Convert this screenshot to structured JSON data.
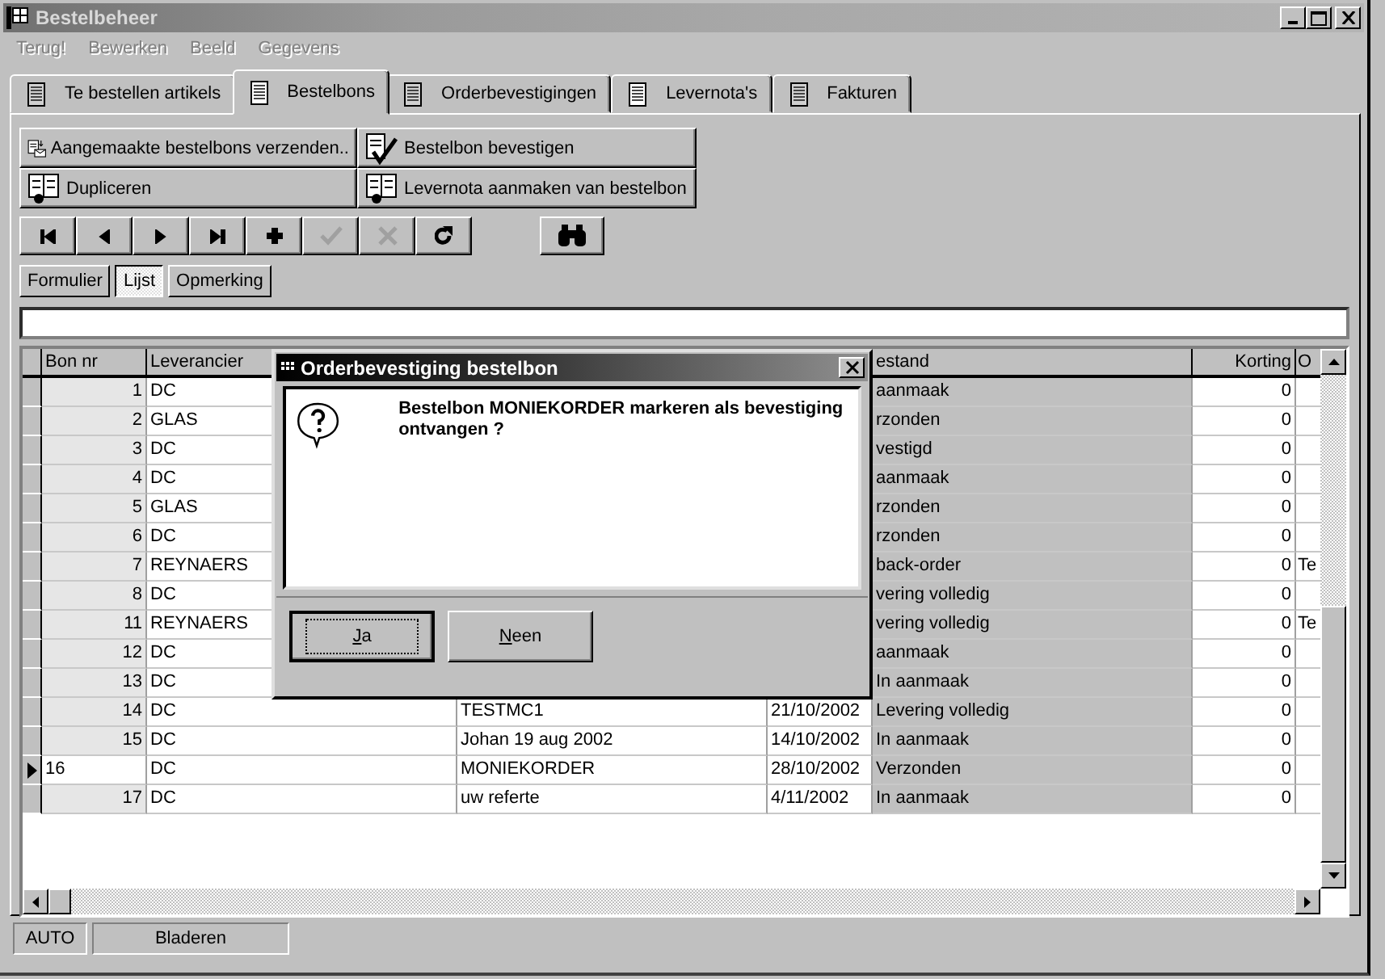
{
  "window": {
    "title": "Bestelbeheer"
  },
  "menu": [
    {
      "label": "Terug!",
      "disabled": true
    },
    {
      "label": "Bewerken",
      "disabled": true
    },
    {
      "label": "Beeld",
      "disabled": true
    },
    {
      "label": "Gegevens",
      "disabled": true
    }
  ],
  "tabs": [
    {
      "label": "Te bestellen artikels",
      "selected": false
    },
    {
      "label": "Bestelbons",
      "selected": true
    },
    {
      "label": "Orderbevestigingen",
      "selected": false
    },
    {
      "label": "Levernota's",
      "selected": false
    },
    {
      "label": "Fakturen",
      "selected": false
    }
  ],
  "actions": [
    {
      "label": "Aangemaakte bestelbons verzenden..",
      "kind": "send"
    },
    {
      "label": "Bestelbon bevestigen",
      "kind": "confirm"
    },
    {
      "label": "Dupliceren",
      "kind": "copy"
    },
    {
      "label": "Levernota aanmaken van bestelbon",
      "kind": "copy"
    }
  ],
  "navigator": [
    {
      "kind": "first",
      "disabled": false
    },
    {
      "kind": "prev",
      "disabled": false
    },
    {
      "kind": "next",
      "disabled": false
    },
    {
      "kind": "last",
      "disabled": false
    },
    {
      "kind": "add",
      "disabled": false
    },
    {
      "kind": "post",
      "disabled": true
    },
    {
      "kind": "cancel",
      "disabled": true
    },
    {
      "kind": "refresh",
      "disabled": false
    }
  ],
  "views": [
    {
      "label": "Formulier",
      "selected": false
    },
    {
      "label": "Lijst",
      "selected": true
    },
    {
      "label": "Opmerking",
      "selected": false
    }
  ],
  "table": {
    "columns": [
      "Bon nr",
      "Leverancier",
      "estand",
      "Korting",
      "O"
    ],
    "rows": [
      {
        "bon_nr": "1",
        "leverancier": "DC",
        "status": "aanmaak",
        "korting": "0",
        "selected": false
      },
      {
        "bon_nr": "2",
        "leverancier": "GLAS",
        "status": "rzonden",
        "korting": "0",
        "selected": false
      },
      {
        "bon_nr": "3",
        "leverancier": "DC",
        "status": "vestigd",
        "korting": "0",
        "selected": false
      },
      {
        "bon_nr": "4",
        "leverancier": "DC",
        "status": "aanmaak",
        "korting": "0",
        "selected": false
      },
      {
        "bon_nr": "5",
        "leverancier": "GLAS",
        "status": "rzonden",
        "korting": "0",
        "selected": false
      },
      {
        "bon_nr": "6",
        "leverancier": "DC",
        "status": "rzonden",
        "korting": "0",
        "selected": false
      },
      {
        "bon_nr": "7",
        "leverancier": "REYNAERS",
        "status": "back-order",
        "korting": "0",
        "column_7": "Te",
        "selected": false
      },
      {
        "bon_nr": "8",
        "leverancier": "DC",
        "status": "vering volledig",
        "korting": "0",
        "selected": false
      },
      {
        "bon_nr": "11",
        "leverancier": "REYNAERS",
        "status": "vering volledig",
        "korting": "0",
        "column_7": "Te",
        "selected": false
      },
      {
        "bon_nr": "12",
        "leverancier": "DC",
        "status": "aanmaak",
        "korting": "0",
        "selected": false
      },
      {
        "bon_nr": "13",
        "leverancier": "DC",
        "status": "In aanmaak",
        "korting": "0",
        "selected": false
      },
      {
        "bon_nr": "14",
        "leverancier": "DC",
        "reference": "TESTMC1",
        "date": "21/10/2002",
        "status": "Levering volledig",
        "korting": "0",
        "selected": false
      },
      {
        "bon_nr": "15",
        "leverancier": "DC",
        "reference": "Johan 19 aug 2002",
        "date": "14/10/2002",
        "status": "In aanmaak",
        "korting": "0",
        "selected": false
      },
      {
        "bon_nr": "16",
        "leverancier": "DC",
        "reference": "MONIEKORDER",
        "date": "28/10/2002",
        "status": "Verzonden",
        "korting": "0",
        "selected": true
      },
      {
        "bon_nr": "17",
        "leverancier": "DC",
        "reference": "uw referte",
        "date": "4/11/2002",
        "status": "In aanmaak",
        "korting": "0",
        "selected": false
      }
    ]
  },
  "dialog": {
    "title": "Orderbevestiging bestelbon",
    "message": "Bestelbon MONIEKORDER markeren als bevestiging ontvangen ?",
    "buttons": [
      {
        "label": "Ja",
        "default": true
      },
      {
        "label": "Neen",
        "default": false
      }
    ]
  },
  "status_bar": [
    "AUTO",
    "Bladeren"
  ]
}
